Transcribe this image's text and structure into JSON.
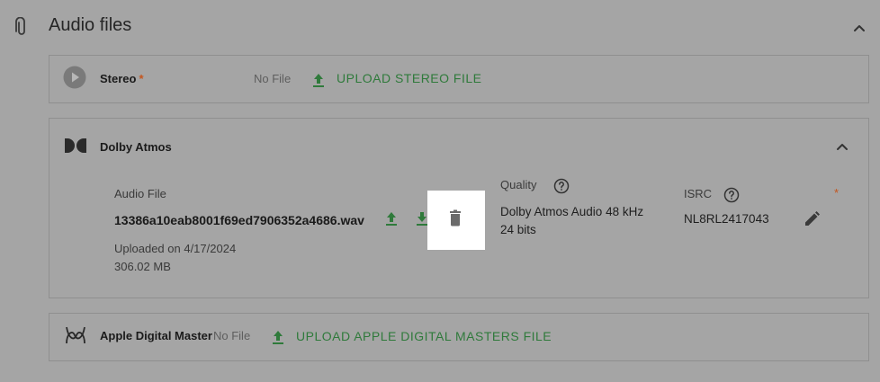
{
  "section": {
    "title": "Audio files"
  },
  "stereo": {
    "label": "Stereo",
    "required_mark": "*",
    "file_status": "No File",
    "upload_label": "UPLOAD STEREO FILE"
  },
  "dolby": {
    "label": "Dolby Atmos",
    "audio_file_label": "Audio File",
    "filename": "13386a10eab8001f69ed7906352a4686.wav",
    "uploaded_on": "Uploaded on 4/17/2024",
    "size": "306.02 MB",
    "quality_label": "Quality",
    "quality_line1": "Dolby Atmos Audio 48 kHz",
    "quality_line2": "24 bits",
    "isrc_label": "ISRC",
    "isrc_value": "NL8RL2417043",
    "required_mark": "*"
  },
  "apple": {
    "label": "Apple Digital Master",
    "file_status": "No File",
    "upload_label": "UPLOAD APPLE DIGITAL MASTERS FILE"
  },
  "colors": {
    "background": "#a5a5a5",
    "accent_green": "#2f7a3b",
    "required": "#c4561e",
    "highlight": "#ffffff"
  },
  "icons": [
    "paperclip-icon",
    "chevron-up-icon",
    "play-icon",
    "upload-icon",
    "download-icon",
    "delete-icon",
    "help-icon",
    "edit-icon",
    "dolby-icon",
    "apple-digital-master-icon"
  ]
}
